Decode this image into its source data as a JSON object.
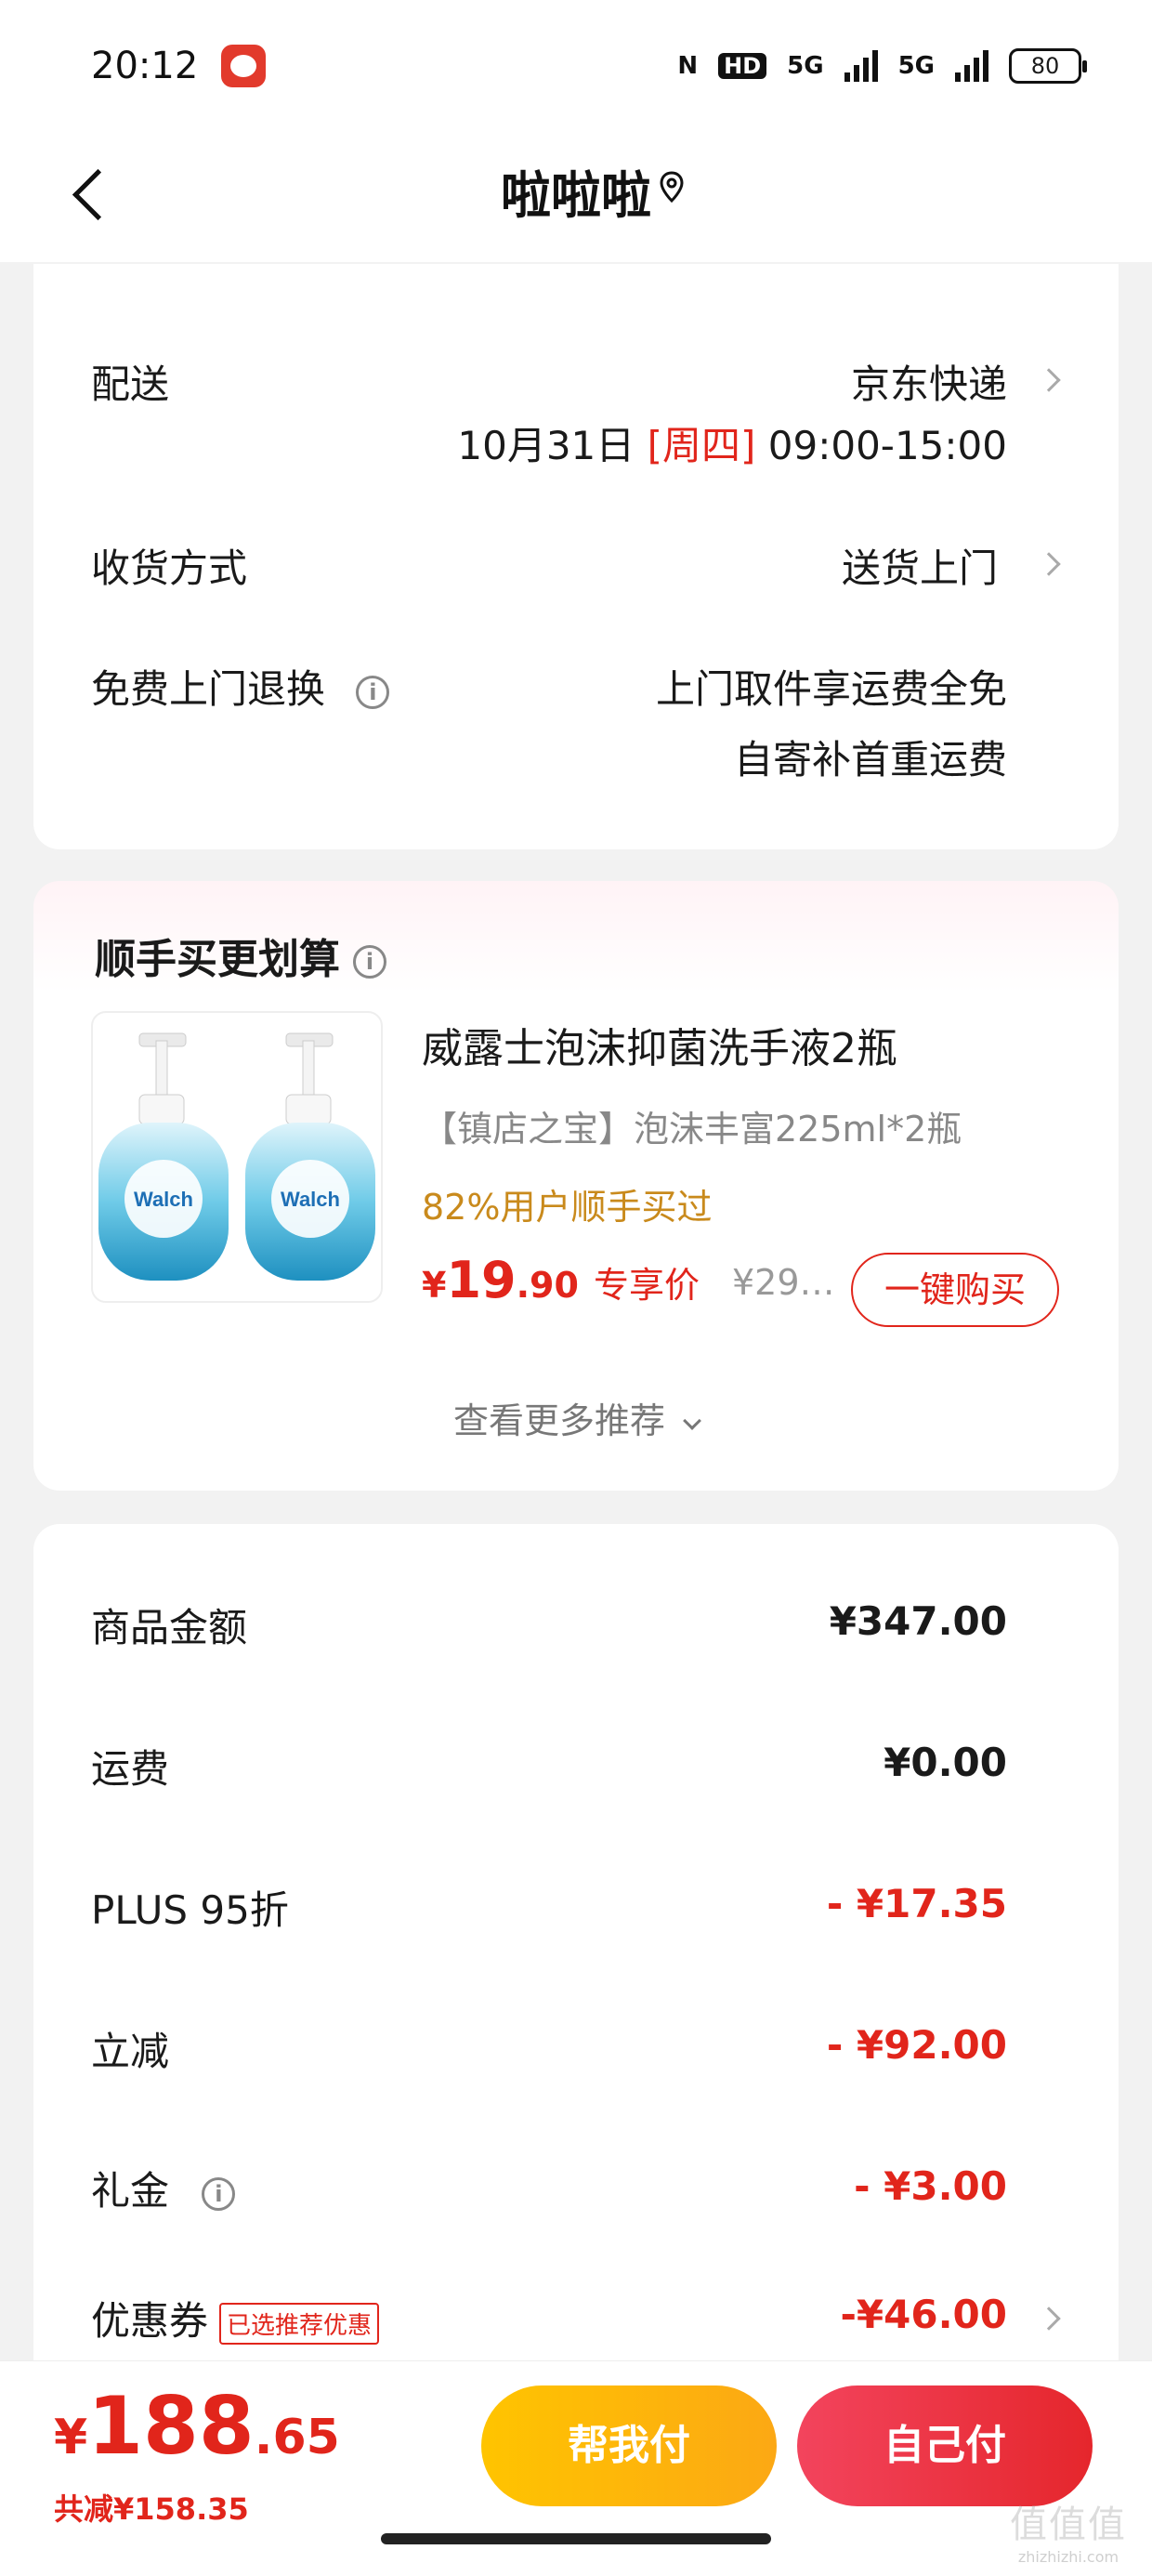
{
  "status_bar": {
    "time": "20:12",
    "network_label": "5G",
    "network_label_2": "5G",
    "hd_label": "HD",
    "battery": "80"
  },
  "header": {
    "title": "啦啦啦"
  },
  "delivery": {
    "shipping_label": "配送",
    "shipping_value": "京东快递",
    "date": "10月31日",
    "weekday": "[周四]",
    "time_window": "09:00-15:00",
    "receive_label": "收货方式",
    "receive_value": "送货上门",
    "return_label": "免费上门退换",
    "return_line1": "上门取件享运费全免",
    "return_line2": "自寄补首重运费"
  },
  "recommend": {
    "title": "顺手买更划算",
    "product": {
      "name": "威露士泡沫抑菌洗手液2瓶",
      "desc": "【镇店之宝】泡沫丰富225ml*2瓶",
      "social": "82%用户顺手买过",
      "currency": "¥",
      "price_int": "19",
      "price_dec": ".90",
      "price_label": "专享价",
      "orig_price": "¥29…",
      "buy_label": "一键购买",
      "brand": "Walch"
    },
    "more_label": "查看更多推荐"
  },
  "summary": {
    "rows": [
      {
        "label": "商品金额",
        "value": "¥347.00"
      },
      {
        "label": "运费",
        "value": "¥0.00"
      },
      {
        "label": "PLUS 95折",
        "value": "- ¥17.35"
      },
      {
        "label": "立减",
        "value": "- ¥92.00"
      },
      {
        "label": "礼金",
        "value": "- ¥3.00"
      },
      {
        "label": "优惠券",
        "value": "-¥46.00",
        "tag": "已选推荐优惠"
      }
    ]
  },
  "bottom": {
    "currency": "¥",
    "total_int": "188",
    "total_dec": ".65",
    "saved": "共减¥158.35",
    "help_pay": "帮我付",
    "self_pay": "自己付"
  },
  "watermark": {
    "glyphs": "值值值",
    "url": "zhizhizhi.com"
  },
  "colors": {
    "accent_red": "#e1251b",
    "gold": "#c98a1c",
    "help_button": "#ffc400",
    "self_button": "#e5262c"
  },
  "icons": [
    "back-arrow-icon",
    "location-pin-icon",
    "chevron-right-icon",
    "info-icon",
    "chevron-down-icon"
  ]
}
